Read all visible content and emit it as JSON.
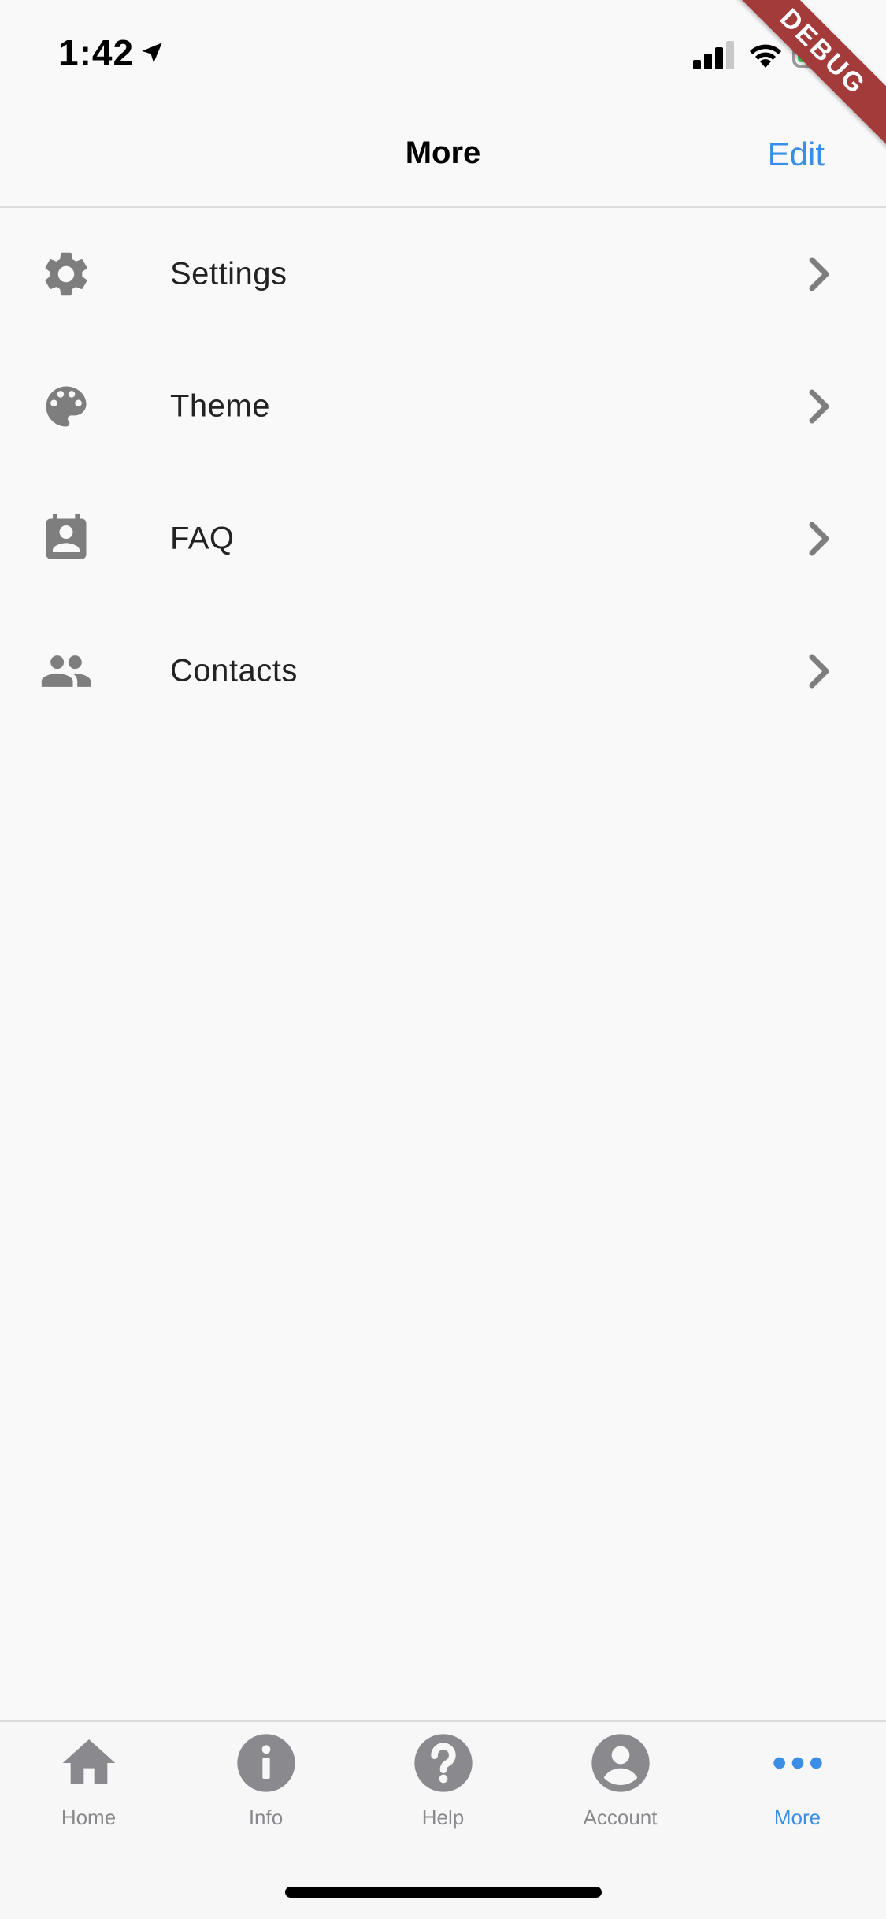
{
  "status_bar": {
    "time": "1:42"
  },
  "debug_banner": {
    "text": "DEBUG"
  },
  "nav": {
    "title": "More",
    "edit_label": "Edit"
  },
  "list": {
    "items": [
      {
        "label": "Settings",
        "icon": "gear-icon"
      },
      {
        "label": "Theme",
        "icon": "palette-icon"
      },
      {
        "label": "FAQ",
        "icon": "contact-card-icon"
      },
      {
        "label": "Contacts",
        "icon": "people-icon"
      }
    ]
  },
  "tabs": [
    {
      "label": "Home",
      "icon": "home-icon"
    },
    {
      "label": "Info",
      "icon": "info-icon"
    },
    {
      "label": "Help",
      "icon": "help-icon"
    },
    {
      "label": "Account",
      "icon": "account-icon"
    },
    {
      "label": "More",
      "icon": "more-icon",
      "active": true
    }
  ],
  "colors": {
    "accent": "#3a8ee6",
    "icon_gray": "#7e7e7e",
    "debug_red": "#a33b3b"
  }
}
